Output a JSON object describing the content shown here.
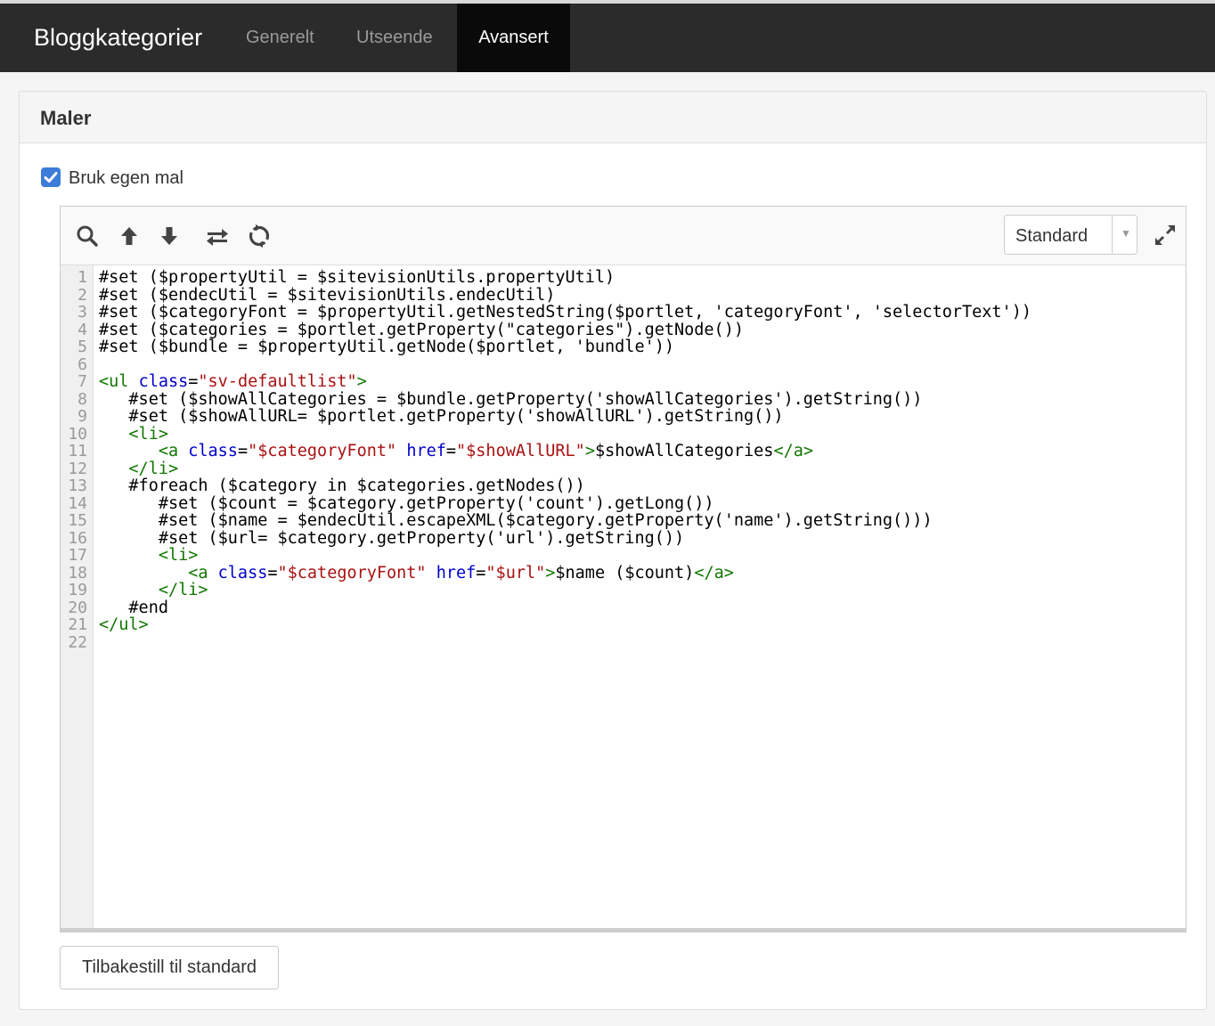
{
  "header": {
    "title": "Bloggkategorier",
    "tabs": [
      {
        "label": "Generelt",
        "active": false
      },
      {
        "label": "Utseende",
        "active": false
      },
      {
        "label": "Avansert",
        "active": true
      }
    ]
  },
  "panel": {
    "title": "Maler",
    "checkbox": {
      "label": "Bruk egen mal",
      "checked": true
    }
  },
  "editor": {
    "toolbar": {
      "icons": [
        "search-icon",
        "arrow-up-icon",
        "arrow-down-icon",
        "swap-icon",
        "refresh-icon"
      ],
      "theme_select": "Standard",
      "expand_icon": "expand-icon"
    },
    "line_numbers": [
      "1",
      "2",
      "3",
      "4",
      "5",
      "6",
      "7",
      "8",
      "9",
      "10",
      "11",
      "12",
      "13",
      "14",
      "15",
      "16",
      "17",
      "18",
      "19",
      "20",
      "21",
      "22"
    ],
    "lines": [
      [
        [
          "",
          "#set ($propertyUtil = $sitevisionUtils.propertyUtil)"
        ]
      ],
      [
        [
          "",
          "#set ($endecUtil = $sitevisionUtils.endecUtil)"
        ]
      ],
      [
        [
          "",
          "#set ($categoryFont = $propertyUtil.getNestedString($portlet, 'categoryFont', 'selectorText'))"
        ]
      ],
      [
        [
          "",
          "#set ($categories = $portlet.getProperty(\"categories\").getNode())"
        ]
      ],
      [
        [
          "",
          "#set ($bundle = $propertyUtil.getNode($portlet, 'bundle'))"
        ]
      ],
      [
        [
          "",
          ""
        ]
      ],
      [
        [
          "tg",
          "<ul "
        ],
        [
          "at",
          "class"
        ],
        [
          "",
          "="
        ],
        [
          "st",
          "\"sv-defaultlist\""
        ],
        [
          "tg",
          ">"
        ]
      ],
      [
        [
          "",
          "   #set ($showAllCategories = $bundle.getProperty('showAllCategories').getString())"
        ]
      ],
      [
        [
          "",
          "   #set ($showAllURL= $portlet.getProperty('showAllURL').getString())"
        ]
      ],
      [
        [
          "tg",
          "   <li>"
        ]
      ],
      [
        [
          "tg",
          "      <a "
        ],
        [
          "at",
          "class"
        ],
        [
          "",
          "="
        ],
        [
          "st",
          "\"$categoryFont\""
        ],
        [
          "",
          " "
        ],
        [
          "at",
          "href"
        ],
        [
          "",
          "="
        ],
        [
          "st",
          "\"$showAllURL\""
        ],
        [
          "tg",
          ">"
        ],
        [
          "",
          "$showAllCategories"
        ],
        [
          "tg",
          "</a>"
        ]
      ],
      [
        [
          "tg",
          "   </li>"
        ]
      ],
      [
        [
          "",
          "   #foreach ($category in $categories.getNodes())"
        ]
      ],
      [
        [
          "",
          "      #set ($count = $category.getProperty('count').getLong())"
        ]
      ],
      [
        [
          "",
          "      #set ($name = $endecUtil.escapeXML($category.getProperty('name').getString()))"
        ]
      ],
      [
        [
          "",
          "      #set ($url= $category.getProperty('url').getString())"
        ]
      ],
      [
        [
          "tg",
          "      <li>"
        ]
      ],
      [
        [
          "tg",
          "         <a "
        ],
        [
          "at",
          "class"
        ],
        [
          "",
          "="
        ],
        [
          "st",
          "\"$categoryFont\""
        ],
        [
          "",
          " "
        ],
        [
          "at",
          "href"
        ],
        [
          "",
          "="
        ],
        [
          "st",
          "\"$url\""
        ],
        [
          "tg",
          ">"
        ],
        [
          "",
          "$name ($count)"
        ],
        [
          "tg",
          "</a>"
        ]
      ],
      [
        [
          "tg",
          "      </li>"
        ]
      ],
      [
        [
          "",
          "   #end"
        ]
      ],
      [
        [
          "tg",
          "</ul>"
        ]
      ],
      [
        [
          "",
          ""
        ]
      ]
    ]
  },
  "footer": {
    "reset_label": "Tilbakestill til standard"
  },
  "colors": {
    "topbar": "#2b2b2b",
    "active_tab": "#0a0a0a",
    "checkbox": "#3b7dd8",
    "tag": "#117700",
    "attribute": "#0000cc",
    "string": "#aa1111"
  }
}
